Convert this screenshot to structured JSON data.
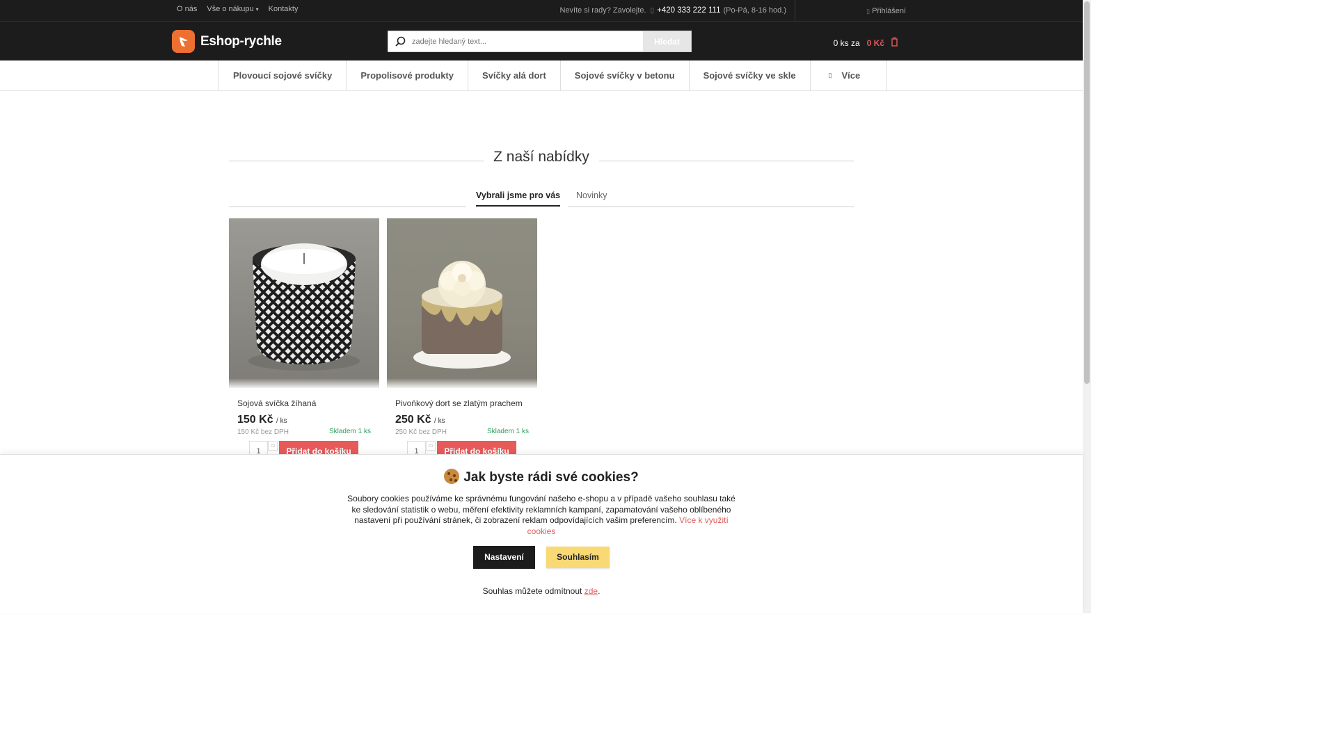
{
  "colors": {
    "topbar_bg": "#1c1c1c",
    "accent_red": "#e85a5a",
    "logo_orange": "#ee7031",
    "stock_green": "#2a9d5c",
    "agree_yellow": "#f8d974"
  },
  "topbar": {
    "links": [
      "O nás",
      "Vše o nákupu",
      "Kontakty"
    ],
    "help_text": "Nevíte si rady? Zavolejte.",
    "phone": "+420 333 222 111",
    "hours": "(Po-Pá, 8-16 hod.)",
    "login": "Přihlášení"
  },
  "header": {
    "logo_text": "Eshop-rychle",
    "search_placeholder": "zadejte hledaný text...",
    "search_button": "Hledat",
    "cart_qty": "0 ks za",
    "cart_price": "0 Kč"
  },
  "nav": {
    "items": [
      "Plovoucí sojové svíčky",
      "Propolisové produkty",
      "Svíčky alá dort",
      "Sojové svíčky v betonu",
      "Sojové svíčky ve skle",
      "Více"
    ]
  },
  "section": {
    "title": "Z naší nabídky",
    "tab_active": "Vybrali jsme pro vás",
    "tab_other": "Novinky"
  },
  "products": [
    {
      "name": "Sojová svíčka žíhaná",
      "price": "150 Kč",
      "unit": "/ ks",
      "price_novat": "150 Kč bez DPH",
      "stock": "Skladem 1 ks",
      "qty": "1",
      "add_label": "Přidat do košíku"
    },
    {
      "name": "Pivoňkový dort se zlatým prachem",
      "price": "250 Kč",
      "unit": "/ ks",
      "price_novat": "250 Kč bez DPH",
      "stock": "Skladem 1 ks",
      "qty": "1",
      "add_label": "Přidat do košíku"
    }
  ],
  "cookie": {
    "title": "Jak byste rádi své cookies?",
    "text": "Soubory cookies používáme ke správnému fungování našeho e-shopu a v případě vašeho souhlasu také ke sledování statistik o webu, měření efektivity reklamních kampaní, zapamatování vašeho oblíbeného nastavení při používání stránek, či zobrazení reklam odpovídajících vašim preferencím.",
    "more_link": "Více k využití cookies",
    "settings_button": "Nastavení",
    "agree_button": "Souhlasím",
    "refuse_text": "Souhlas můžete odmítnout",
    "refuse_link": "zde",
    "refuse_end": "."
  }
}
